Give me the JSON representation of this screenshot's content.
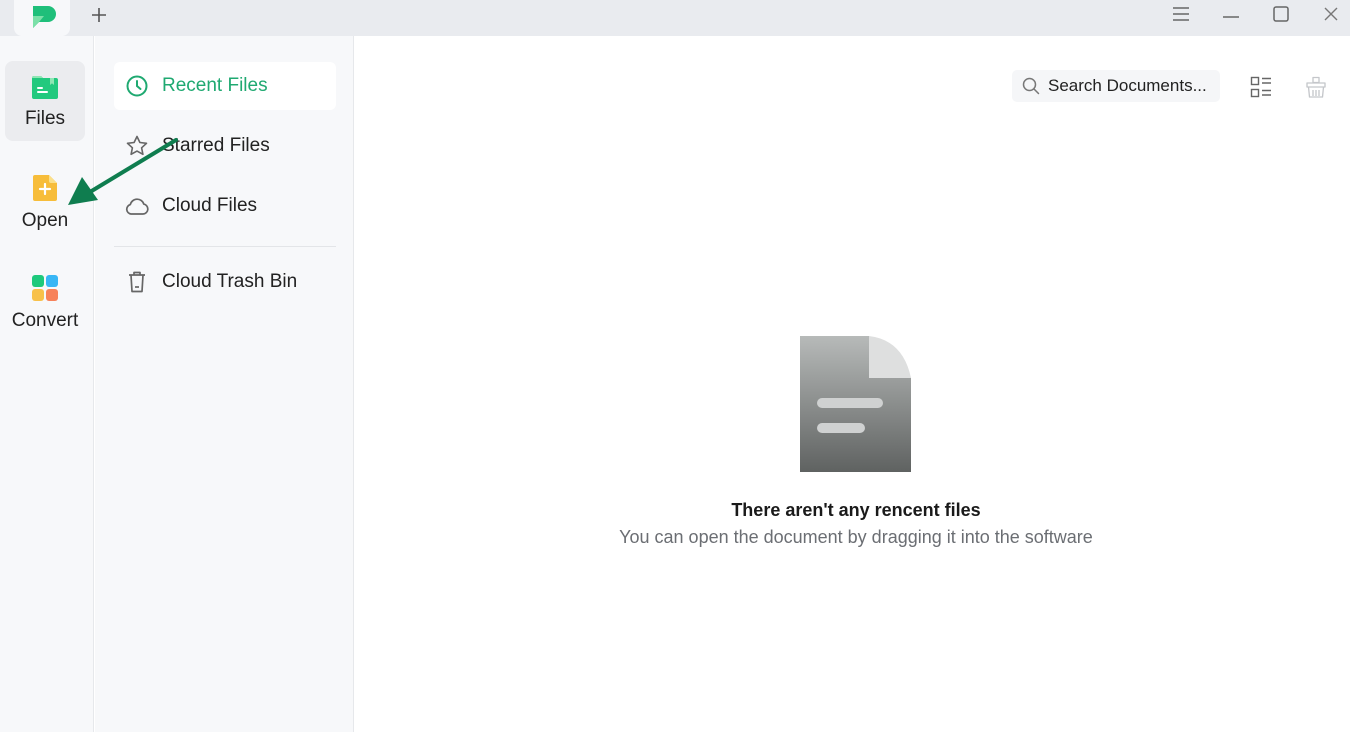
{
  "titlebar": {
    "new_tab_label": "+",
    "controls": [
      "menu-icon",
      "minimize-icon",
      "maximize-icon",
      "close-icon"
    ]
  },
  "rail": {
    "items": [
      {
        "label": "Files",
        "icon": "files-folder-icon",
        "active": true
      },
      {
        "label": "Open",
        "icon": "open-file-plus-icon",
        "active": false
      },
      {
        "label": "Convert",
        "icon": "convert-grid-icon",
        "active": false
      }
    ]
  },
  "nav": {
    "items": [
      {
        "label": "Recent Files",
        "icon": "clock-icon",
        "active": true
      },
      {
        "label": "Starred Files",
        "icon": "star-icon",
        "active": false
      },
      {
        "label": "Cloud Files",
        "icon": "cloud-icon",
        "active": false
      },
      {
        "label": "Cloud Trash Bin",
        "icon": "trash-icon",
        "active": false
      }
    ]
  },
  "main": {
    "search_placeholder": "Search Documents...",
    "empty_title": "There aren't any rencent files",
    "empty_subtitle": "You can open the document by dragging it into the software"
  },
  "colors": {
    "accent": "#1fa971",
    "annotation_arrow": "#0f7d4f"
  }
}
